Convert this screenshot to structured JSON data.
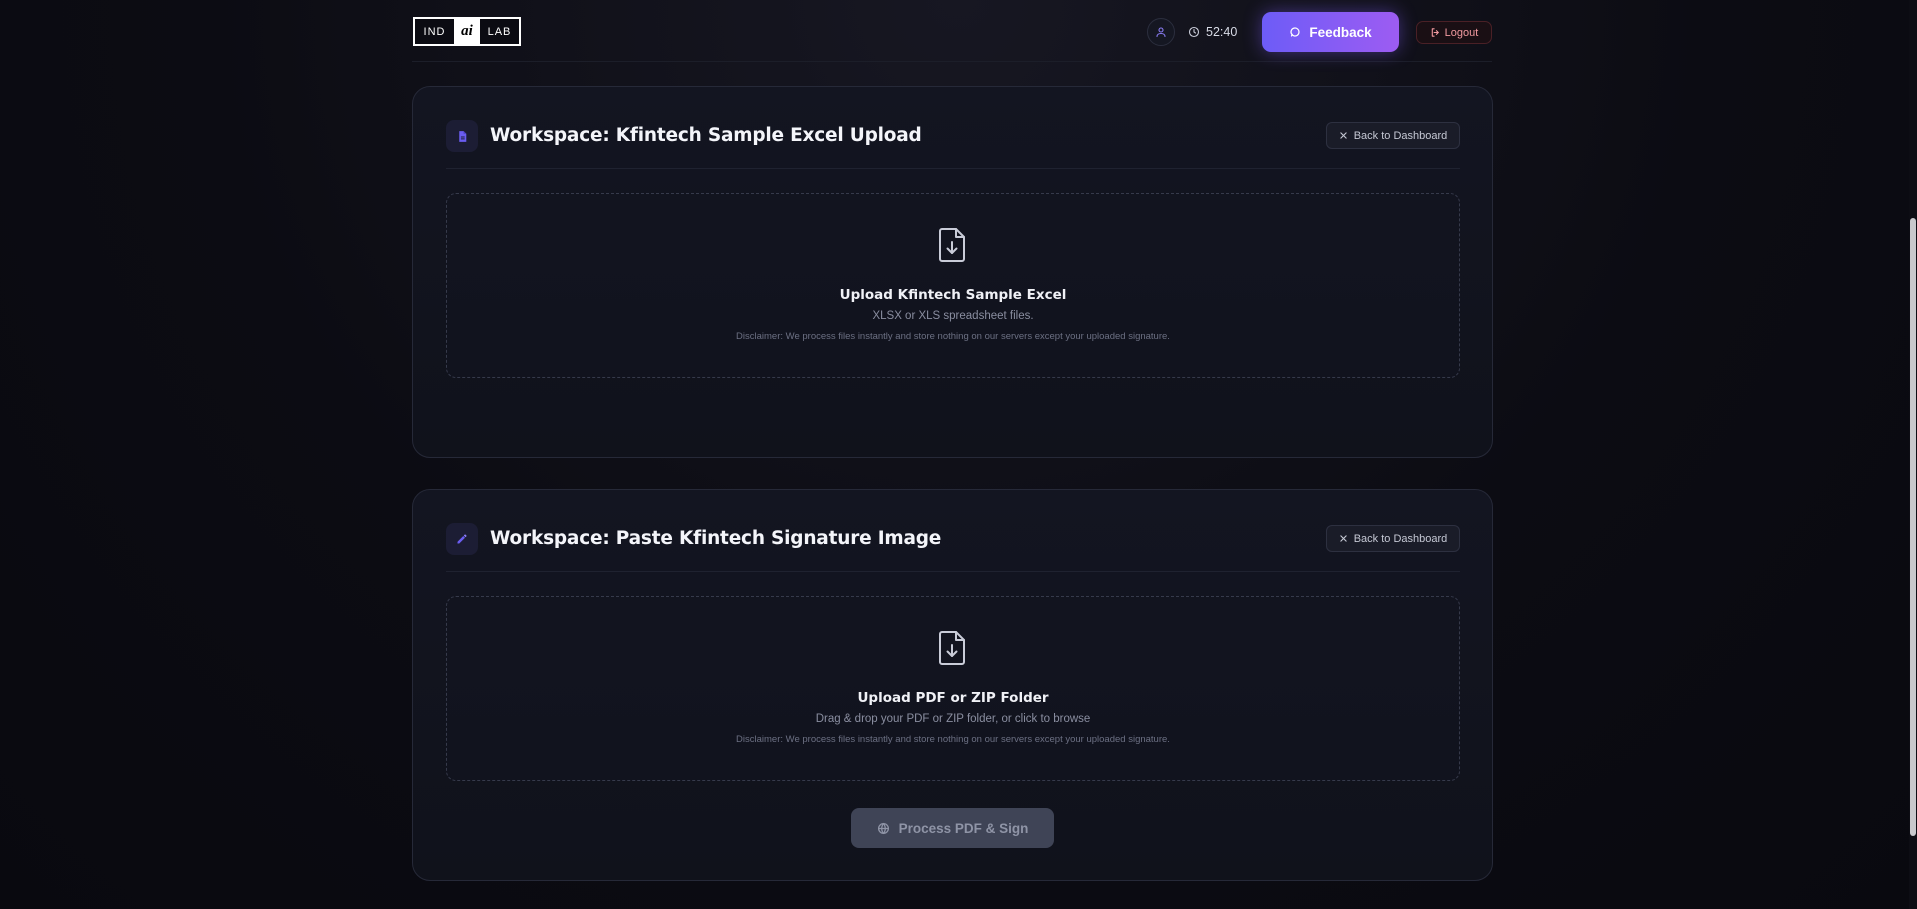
{
  "header": {
    "logo": {
      "left": "IND",
      "middle": "ai",
      "right": "LAB"
    },
    "timer": "52:40",
    "feedback_label": "Feedback",
    "logout_label": "Logout"
  },
  "workspaces": [
    {
      "title": "Workspace: Kfintech Sample Excel Upload",
      "back_label": "Back to Dashboard",
      "icon": "document-icon",
      "dropzone": {
        "title": "Upload Kfintech Sample Excel",
        "subtitle": "XLSX or XLS spreadsheet files.",
        "disclaimer": "Disclaimer: We process files instantly and store nothing on our servers except your uploaded signature."
      }
    },
    {
      "title": "Workspace: Paste Kfintech Signature Image",
      "back_label": "Back to Dashboard",
      "icon": "pencil-icon",
      "dropzone": {
        "title": "Upload PDF or ZIP Folder",
        "subtitle": "Drag & drop your PDF or ZIP folder, or click to browse",
        "disclaimer": "Disclaimer: We process files instantly and store nothing on our servers except your uploaded signature."
      },
      "action_label": "Process PDF & Sign"
    }
  ],
  "colors": {
    "accent_start": "#6d5cf7",
    "accent_end": "#9d5cf2",
    "logout": "#f29aa0",
    "background": "#0b0b12"
  }
}
